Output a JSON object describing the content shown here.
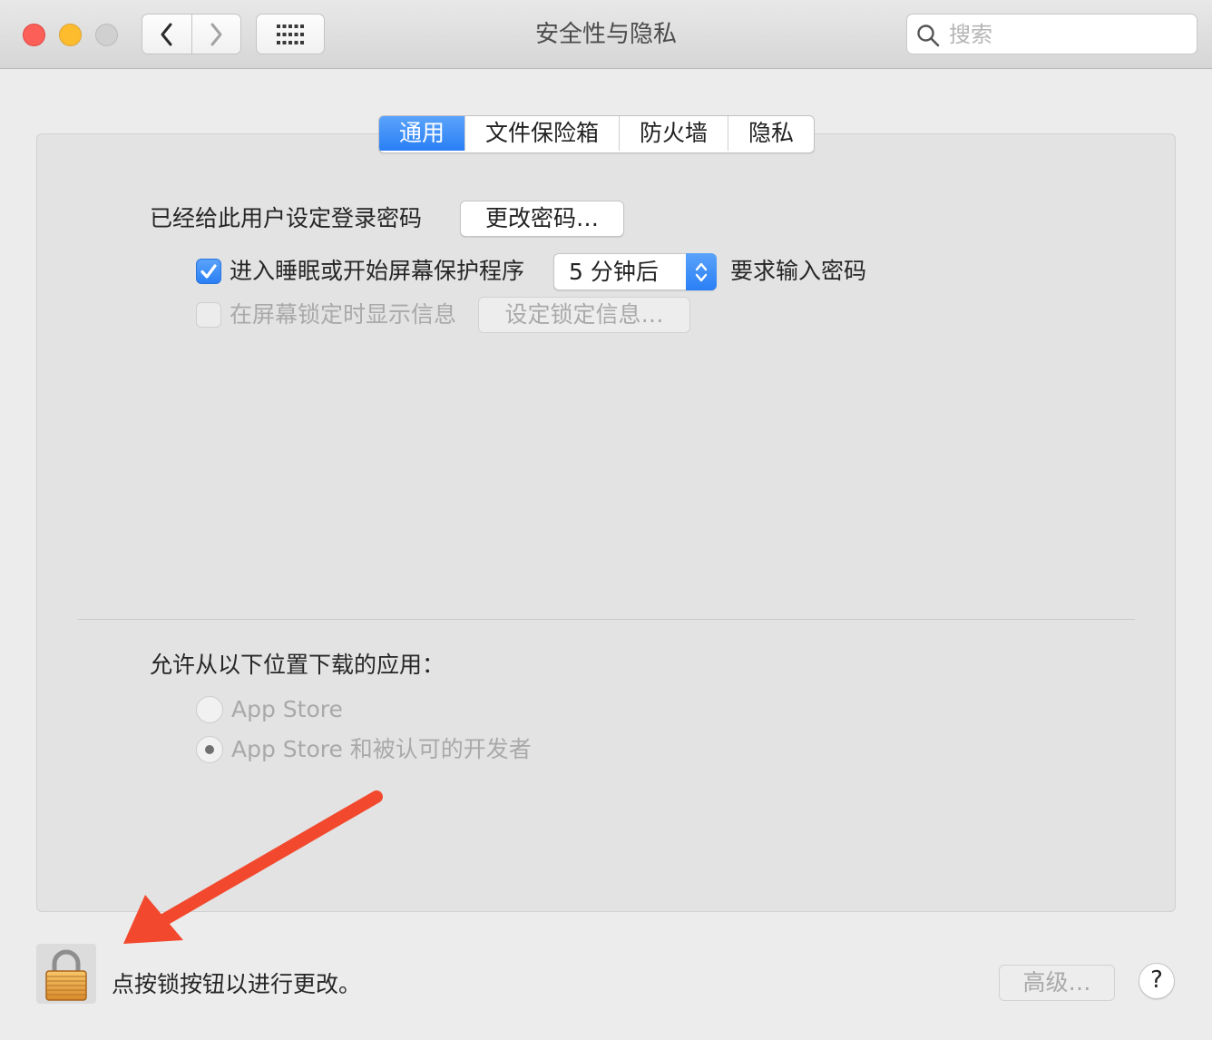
{
  "window": {
    "title": "安全性与隐私",
    "search_placeholder": "搜索"
  },
  "tabs": [
    {
      "label": "通用",
      "active": true
    },
    {
      "label": "文件保险箱",
      "active": false
    },
    {
      "label": "防火墙",
      "active": false
    },
    {
      "label": "隐私",
      "active": false
    }
  ],
  "general": {
    "password_set_label": "已经给此用户设定登录密码",
    "change_password_button": "更改密码…",
    "require_password": {
      "checked": true,
      "label": "进入睡眠或开始屏幕保护程序",
      "delay_value": "5 分钟后",
      "suffix": "要求输入密码"
    },
    "lock_message": {
      "checked": false,
      "label": "在屏幕锁定时显示信息",
      "button": "设定锁定信息…"
    },
    "download_section": {
      "title": "允许从以下位置下载的应用：",
      "options": [
        {
          "label": "App Store",
          "selected": false
        },
        {
          "label": "App Store 和被认可的开发者",
          "selected": true
        }
      ]
    }
  },
  "footer": {
    "lock_text": "点按锁按钮以进行更改。",
    "advanced_button": "高级…",
    "help_button": "?"
  },
  "colors": {
    "accent": "#2a7ff5",
    "annotation_arrow": "#f2492e",
    "close": "#fc5f57",
    "minimize": "#fdbc2e"
  }
}
